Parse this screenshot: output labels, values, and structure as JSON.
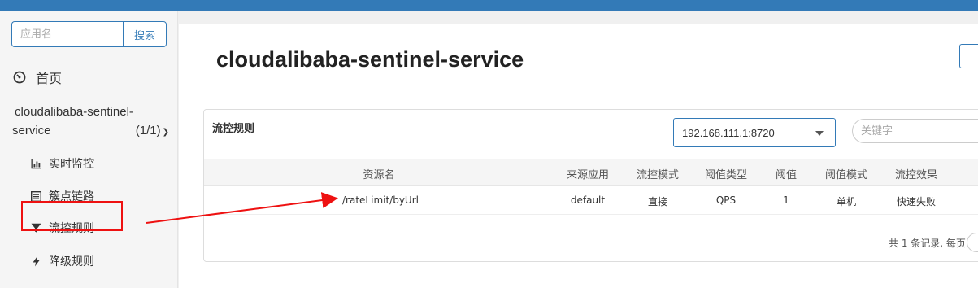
{
  "colors": {
    "accent": "#337ab7",
    "annotation": "#e11111"
  },
  "search": {
    "placeholder": "应用名",
    "button_label": "搜索"
  },
  "sidebar": {
    "home_label": "首页",
    "app": {
      "name_line1": "cloudalibaba-sentinel-",
      "name_line2": "service",
      "count": "(1/1)"
    },
    "items": [
      {
        "label": "实时监控",
        "icon": "bar-chart-icon"
      },
      {
        "label": "簇点链路",
        "icon": "list-icon"
      },
      {
        "label": "流控规则",
        "icon": "filter-icon"
      },
      {
        "label": "降级规则",
        "icon": "flash-icon"
      }
    ]
  },
  "main": {
    "title": "cloudalibaba-sentinel-service",
    "panel_title": "流控规则",
    "machine_select": "192.168.111.1:8720",
    "keyword_placeholder": "关键字",
    "table": {
      "headers": [
        "资源名",
        "来源应用",
        "流控模式",
        "阈值类型",
        "阈值",
        "阈值模式",
        "流控效果"
      ],
      "rows": [
        [
          "/rateLimit/byUrl",
          "default",
          "直接",
          "QPS",
          "1",
          "单机",
          "快速失败"
        ]
      ]
    },
    "pager_text": "共 1 条记录, 每页"
  }
}
